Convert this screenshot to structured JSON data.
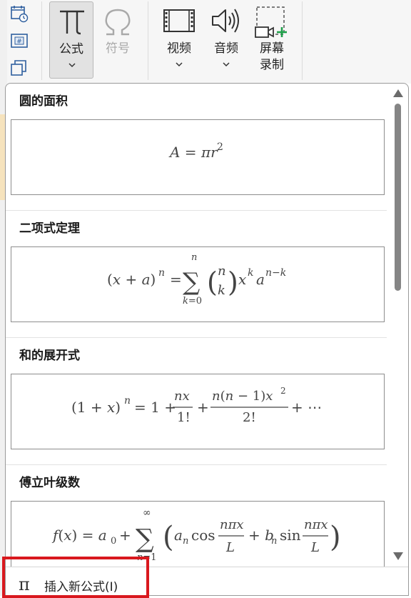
{
  "ribbon": {
    "buttons": [
      {
        "id": "formula",
        "label": "公式",
        "glyph": "π",
        "icon": "pi-icon",
        "active": true,
        "has_dropdown": true
      },
      {
        "id": "symbol",
        "label": "符号",
        "glyph": "Ω",
        "icon": "omega-icon",
        "disabled": true
      },
      {
        "id": "video",
        "label": "视频",
        "icon": "video-film-icon",
        "has_dropdown": true
      },
      {
        "id": "audio",
        "label": "音频",
        "icon": "speaker-icon",
        "has_dropdown": true
      },
      {
        "id": "screen_record",
        "label_line1": "屏幕",
        "label_line2": "录制",
        "icon": "screen-record-icon"
      }
    ],
    "small_icons": [
      "date-time-icon",
      "number-field-icon",
      "object-icon"
    ]
  },
  "gallery": {
    "sections": [
      {
        "title": "圆的面积",
        "equation": "A = πr²"
      },
      {
        "title": "二项式定理",
        "equation": "(x + a)ⁿ = Σ_{k=0}^{n} (n k) xᵏ aⁿ⁻ᵏ"
      },
      {
        "title": "和的展开式",
        "equation": "(1 + x)ⁿ = 1 + nx/1! + n(n − 1)x²/2! + ⋯"
      },
      {
        "title": "傅立叶级数",
        "equation": "f(x) = a₀ + Σ_{n=1}^{∞} (aₙ cos nπx/L + bₙ sin nπx/L)"
      }
    ]
  },
  "footer": {
    "insert_label": "插入新公式(I)",
    "icon": "pi-icon"
  },
  "colors": {
    "highlight": "#d9181e",
    "active_bg": "#e2e2e2",
    "eq_text": "#444444",
    "accent_green": "#1ea04a"
  }
}
